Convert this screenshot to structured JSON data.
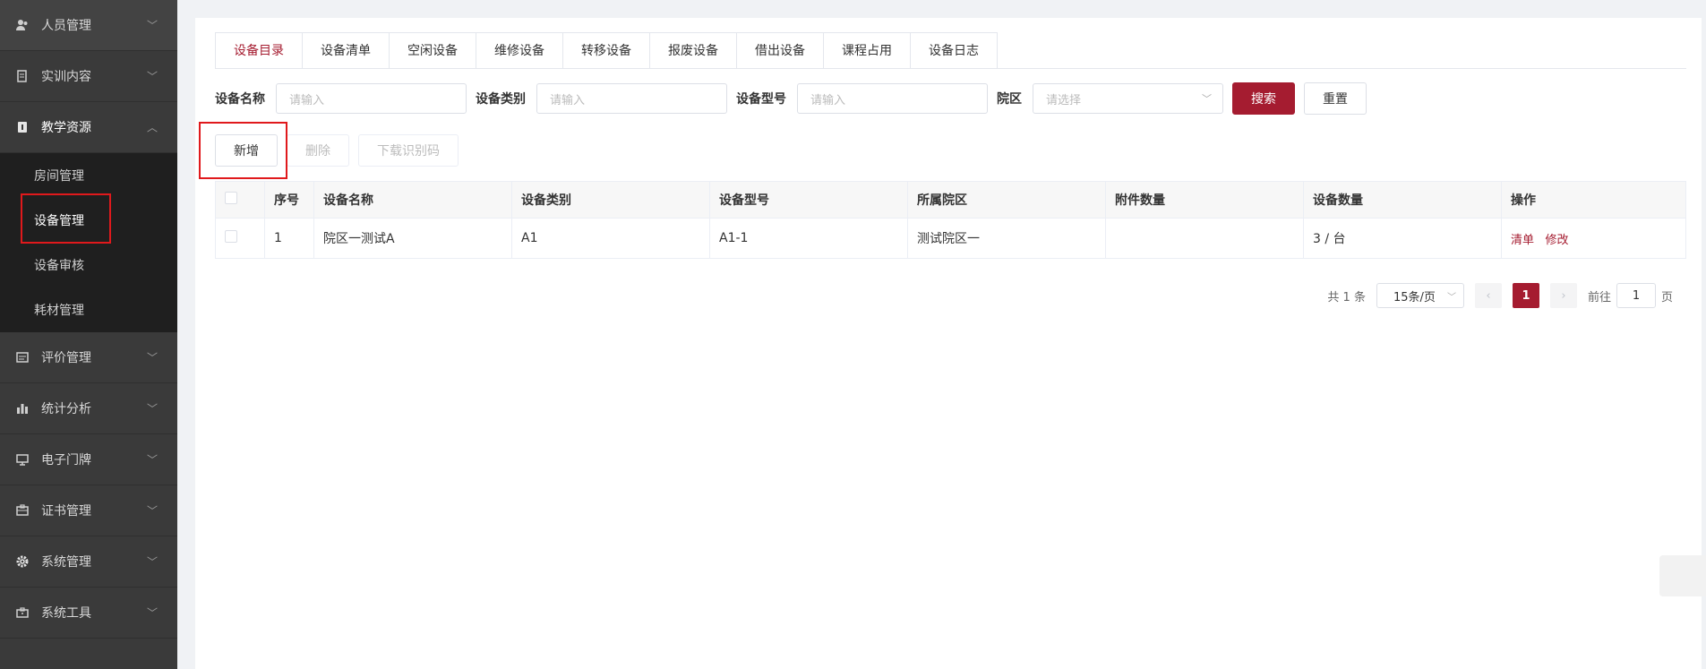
{
  "sidebar": {
    "items_top": [
      {
        "label": "人员管理",
        "icon": "users-icon"
      },
      {
        "label": "实训内容",
        "icon": "book-icon"
      },
      {
        "label": "教学资源",
        "icon": "resource-icon"
      }
    ],
    "submenu": [
      "房间管理",
      "设备管理",
      "设备审核",
      "耗材管理"
    ],
    "items_bottom": [
      {
        "label": "评价管理",
        "icon": "evaluation-icon"
      },
      {
        "label": "统计分析",
        "icon": "bar-chart-icon"
      },
      {
        "label": "电子门牌",
        "icon": "monitor-icon"
      },
      {
        "label": "证书管理",
        "icon": "certificate-icon"
      },
      {
        "label": "系统管理",
        "icon": "gear-icon"
      },
      {
        "label": "系统工具",
        "icon": "toolbox-icon"
      }
    ]
  },
  "tabs": [
    "设备目录",
    "设备清单",
    "空闲设备",
    "维修设备",
    "转移设备",
    "报废设备",
    "借出设备",
    "课程占用",
    "设备日志"
  ],
  "search": {
    "name_label": "设备名称",
    "name_placeholder": "请输入",
    "category_label": "设备类别",
    "category_placeholder": "请输入",
    "model_label": "设备型号",
    "model_placeholder": "请输入",
    "campus_label": "院区",
    "campus_placeholder": "请选择",
    "search_button": "搜索",
    "reset_button": "重置"
  },
  "toolbar": {
    "add": "新增",
    "delete": "删除",
    "download": "下载识别码"
  },
  "table": {
    "headers": [
      "序号",
      "设备名称",
      "设备类别",
      "设备型号",
      "所属院区",
      "附件数量",
      "设备数量",
      "操作"
    ],
    "rows": [
      {
        "index": "1",
        "name": "院区一测试A",
        "category": "A1",
        "model": "A1-1",
        "campus": "测试院区一",
        "attachments": "",
        "quantity": "3 / 台",
        "action_list": "清单",
        "action_edit": "修改"
      }
    ]
  },
  "pager": {
    "total": "共 1 条",
    "page_size": "15条/页",
    "current": "1",
    "goto_label": "前往",
    "goto_value": "1",
    "page_unit": "页"
  },
  "colors": {
    "accent": "#a51c30",
    "sidebar": "#3a3a3a",
    "highlight_box": "#e0191c"
  }
}
